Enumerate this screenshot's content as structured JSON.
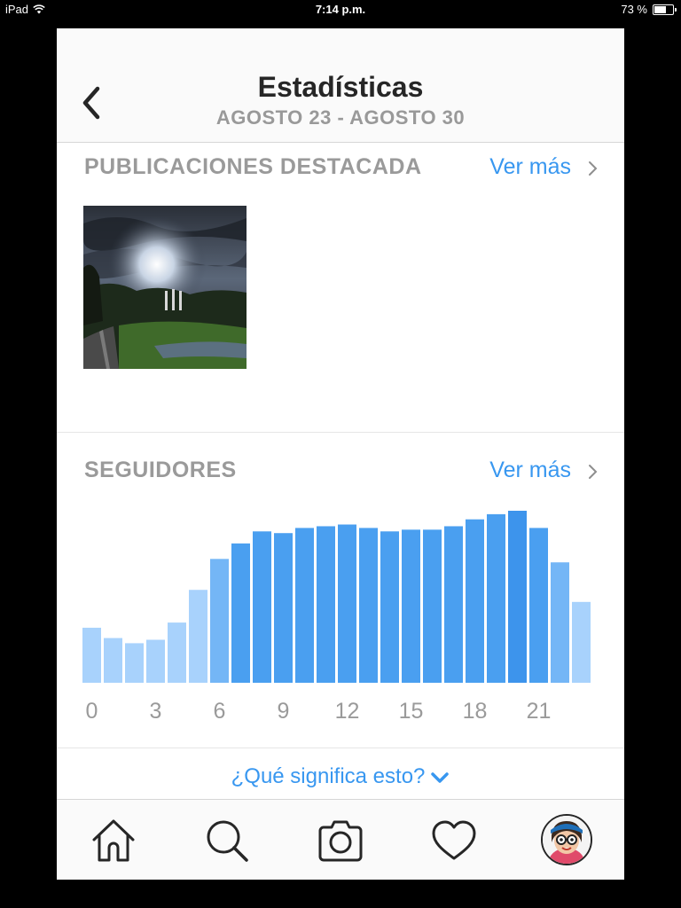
{
  "status_bar": {
    "device": "iPad",
    "time": "7:14 p.m.",
    "battery": "73 %",
    "battery_level": 0.73
  },
  "header": {
    "title": "Estadísticas",
    "subtitle": "AGOSTO 23 - AGOSTO 30",
    "back_icon": "chevron-left-icon"
  },
  "top_posts": {
    "title": "PUBLICACIONES DESTACADA",
    "see_more": "Ver más"
  },
  "followers": {
    "title": "SEGUIDORES",
    "see_more": "Ver más"
  },
  "chart_data": {
    "type": "bar",
    "categories": [
      0,
      1,
      2,
      3,
      4,
      5,
      6,
      7,
      8,
      9,
      10,
      11,
      12,
      13,
      14,
      15,
      16,
      17,
      18,
      19,
      20,
      21,
      22,
      23
    ],
    "values": [
      32,
      26,
      23,
      25,
      35,
      54,
      72,
      81,
      88,
      87,
      90,
      91,
      92,
      90,
      88,
      89,
      89,
      91,
      95,
      98,
      100,
      90,
      70,
      47
    ],
    "tick_labels": [
      "0",
      "3",
      "6",
      "9",
      "12",
      "15",
      "18",
      "21"
    ],
    "tick_positions": [
      0,
      3,
      6,
      9,
      12,
      15,
      18,
      21
    ],
    "ylim": [
      0,
      100
    ],
    "colors": {
      "light": "#a8d2fc",
      "medium": "#74b6f6",
      "strong": "#4a9ff0",
      "peak": "#3d94ec"
    },
    "grid": false,
    "legend": "none"
  },
  "help": {
    "label": "¿Qué significa esto?"
  },
  "tab_bar": {
    "items": [
      "home-icon",
      "search-icon",
      "camera-icon",
      "heart-icon",
      "profile-avatar"
    ]
  }
}
